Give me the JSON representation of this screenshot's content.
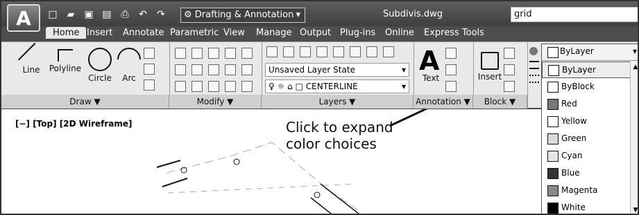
{
  "window": {
    "workspace": "Drafting & Annotation",
    "file_name": "Subdivis.dwg",
    "search_value": "grid"
  },
  "tabs": [
    "Home",
    "Insert",
    "Annotate",
    "Parametric",
    "View",
    "Manage",
    "Output",
    "Plug-ins",
    "Online",
    "Express Tools"
  ],
  "tools": {
    "line": "Line",
    "polyline": "Polyline",
    "circle": "Circle",
    "arc": "Arc",
    "text": "Text",
    "insert": "Insert"
  },
  "panels": {
    "draw": "Draw ▼",
    "modify": "Modify ▼",
    "layers": "Layers ▼",
    "annotation": "Annotation ▼",
    "block": "Block ▼"
  },
  "layers": {
    "state": "Unsaved Layer State",
    "current": "CENTERLINE"
  },
  "canvas": {
    "view_label": "[−] [Top] [2D Wireframe]",
    "callout": "Click to expand\ncolor choices"
  },
  "color_dropdown": {
    "selected": "ByLayer",
    "items": [
      {
        "label": "ByLayer",
        "color": "#ffffff"
      },
      {
        "label": "ByBlock",
        "color": "#ffffff"
      },
      {
        "label": "Red",
        "color": "#777777"
      },
      {
        "label": "Yellow",
        "color": "#ffffff"
      },
      {
        "label": "Green",
        "color": "#d9d9d9"
      },
      {
        "label": "Cyan",
        "color": "#e6e6e6"
      },
      {
        "label": "Blue",
        "color": "#333333"
      },
      {
        "label": "Magenta",
        "color": "#888888"
      },
      {
        "label": "White",
        "color": "#000000"
      }
    ]
  }
}
